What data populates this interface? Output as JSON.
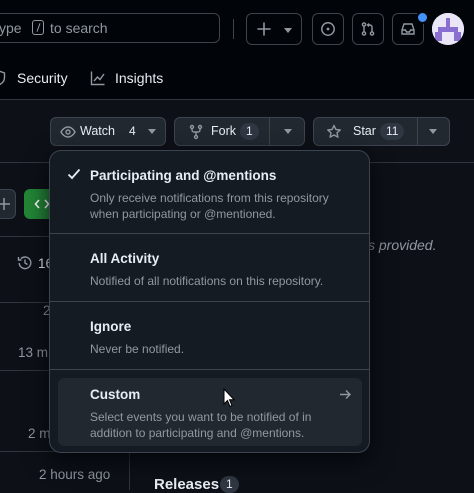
{
  "header": {
    "search_prefix": "ype",
    "search_suffix": "to search"
  },
  "repo_tabs": [
    {
      "label": "Security",
      "icon": "shield-icon"
    },
    {
      "label": "Insights",
      "icon": "graph-icon"
    }
  ],
  "actions": {
    "watch": {
      "label": "Watch",
      "count": "4"
    },
    "fork": {
      "label": "Fork",
      "count": "1"
    },
    "star": {
      "label": "Star",
      "count": "11"
    }
  },
  "background": {
    "description_fragment": "s provided.",
    "commits_fragment": "16",
    "row_times": [
      "2",
      "13 m",
      "",
      "2 m",
      "2 hours ago"
    ],
    "releases_label": "Releases",
    "releases_count": "1"
  },
  "watch_menu": {
    "items": [
      {
        "title": "Participating and @mentions",
        "description": "Only receive notifications from this repository when participating or @mentioned.",
        "selected": true
      },
      {
        "title": "All Activity",
        "description": "Notified of all notifications on this repository.",
        "selected": false
      },
      {
        "title": "Ignore",
        "description": "Never be notified.",
        "selected": false
      },
      {
        "title": "Custom",
        "description": "Select events you want to be notified of in addition to participating and @mentions.",
        "selected": false,
        "has_submenu": true
      }
    ]
  },
  "colors": {
    "page_bg": "#0d1117",
    "header_bg": "#010409",
    "menu_bg": "#151b23",
    "accent_blue": "#4493f8",
    "primary_green": "#238636"
  }
}
